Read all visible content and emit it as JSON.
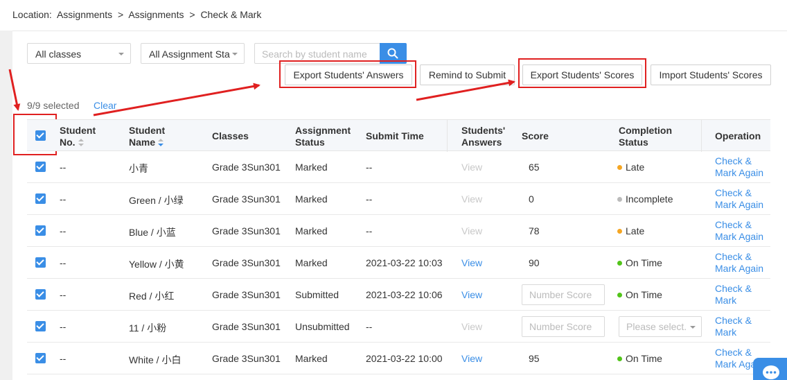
{
  "breadcrumb": {
    "prefix": "Location:",
    "items": [
      "Assignments",
      ">",
      "Assignments",
      ">",
      "Check & Mark"
    ]
  },
  "filters": {
    "class_select": "All classes",
    "status_select": "All Assignment Sta",
    "search_placeholder": "Search by student name"
  },
  "actions": {
    "export_answers": "Export Students' Answers",
    "remind": "Remind to Submit",
    "export_scores": "Export Students' Scores",
    "import_scores": "Import Students' Scores"
  },
  "selection": {
    "text": "9/9 selected",
    "clear": "Clear"
  },
  "table": {
    "headers": {
      "student_no": [
        "Student",
        "No."
      ],
      "student_name": [
        "Student",
        "Name"
      ],
      "classes": "Classes",
      "assignment_status": [
        "Assignment",
        "Status"
      ],
      "submit_time": "Submit Time",
      "answers": [
        "Students'",
        "Answers"
      ],
      "score": "Score",
      "completion": [
        "Completion",
        "Status"
      ],
      "operation": "Operation"
    },
    "rows": [
      {
        "no": "--",
        "name": "小青",
        "class": "Grade 3Sun301",
        "status": "Marked",
        "time": "--",
        "view": "View",
        "view_enabled": false,
        "score": "65",
        "completion": "Late",
        "completion_color": "#f5a623",
        "op1": "Check &",
        "op2": "Mark Again"
      },
      {
        "no": "--",
        "name": "Green / 小绿",
        "class": "Grade 3Sun301",
        "status": "Marked",
        "time": "--",
        "view": "View",
        "view_enabled": false,
        "score": "0",
        "completion": "Incomplete",
        "completion_color": "#bbbbbb",
        "op1": "Check &",
        "op2": "Mark Again"
      },
      {
        "no": "--",
        "name": "Blue / 小蓝",
        "class": "Grade 3Sun301",
        "status": "Marked",
        "time": "--",
        "view": "View",
        "view_enabled": false,
        "score": "78",
        "completion": "Late",
        "completion_color": "#f5a623",
        "op1": "Check &",
        "op2": "Mark Again"
      },
      {
        "no": "--",
        "name": "Yellow / 小黄",
        "class": "Grade 3Sun301",
        "status": "Marked",
        "time": "2021-03-22 10:03",
        "view": "View",
        "view_enabled": true,
        "score": "90",
        "completion": "On Time",
        "completion_color": "#52c41a",
        "op1": "Check &",
        "op2": "Mark Again"
      },
      {
        "no": "--",
        "name": "Red / 小红",
        "class": "Grade 3Sun301",
        "status": "Submitted",
        "time": "2021-03-22 10:06",
        "view": "View",
        "view_enabled": true,
        "score_placeholder": "Number Score",
        "completion": "On Time",
        "completion_color": "#52c41a",
        "op1": "Check &",
        "op2": "Mark"
      },
      {
        "no": "--",
        "name": "11 / 小粉",
        "class": "Grade 3Sun301",
        "status": "Unsubmitted",
        "time": "--",
        "view": "View",
        "view_enabled": false,
        "score_placeholder": "Number Score",
        "completion_placeholder": "Please select.",
        "op1": "Check &",
        "op2": "Mark"
      },
      {
        "no": "--",
        "name": "White / 小白",
        "class": "Grade 3Sun301",
        "status": "Marked",
        "time": "2021-03-22 10:00",
        "view": "View",
        "view_enabled": true,
        "score": "95",
        "completion": "On Time",
        "completion_color": "#52c41a",
        "op1": "Check &",
        "op2": "Mark Again"
      }
    ]
  },
  "colors": {
    "accent": "#3a8ee6",
    "annotation_red": "#e02020"
  }
}
